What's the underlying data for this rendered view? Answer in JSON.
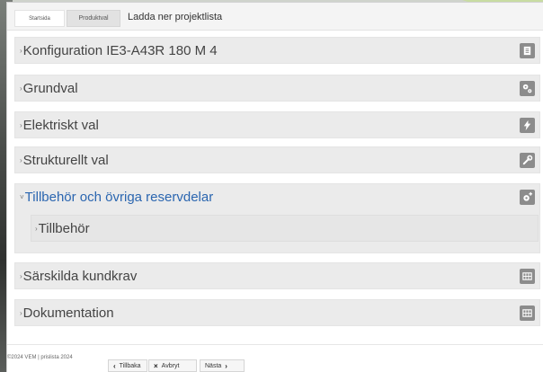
{
  "tabs": {
    "start_label": "Startsida",
    "product_label": "Produktval",
    "download_label": "Ladda ner projektlista"
  },
  "sections": [
    {
      "label": "Konfiguration IE3-A43R 180 M 4",
      "icon": "document-icon"
    },
    {
      "label": "Grundval",
      "icon": "gears-icon"
    },
    {
      "label": "Elektriskt val",
      "icon": "lightning-icon"
    },
    {
      "label": "Strukturellt val",
      "icon": "wrench-icon"
    },
    {
      "label": "Tillbehör och övriga reservdelar",
      "icon": "gear-plus-icon",
      "expanded": true
    },
    {
      "label": "Särskilda kundkrav",
      "icon": "grid-icon"
    },
    {
      "label": "Dokumentation",
      "icon": "grid-icon"
    }
  ],
  "subsection": {
    "label": "Tillbehör"
  },
  "footer": {
    "copyright": "©2024 VEM | prislista 2024",
    "back_label": "Tillbaka",
    "cancel_label": "Avbryt",
    "next_label": "Nästa"
  },
  "colors": {
    "active_section": "#2b66b0",
    "section_bg": "#ebebeb",
    "icon_bg": "#8c8c8c"
  }
}
